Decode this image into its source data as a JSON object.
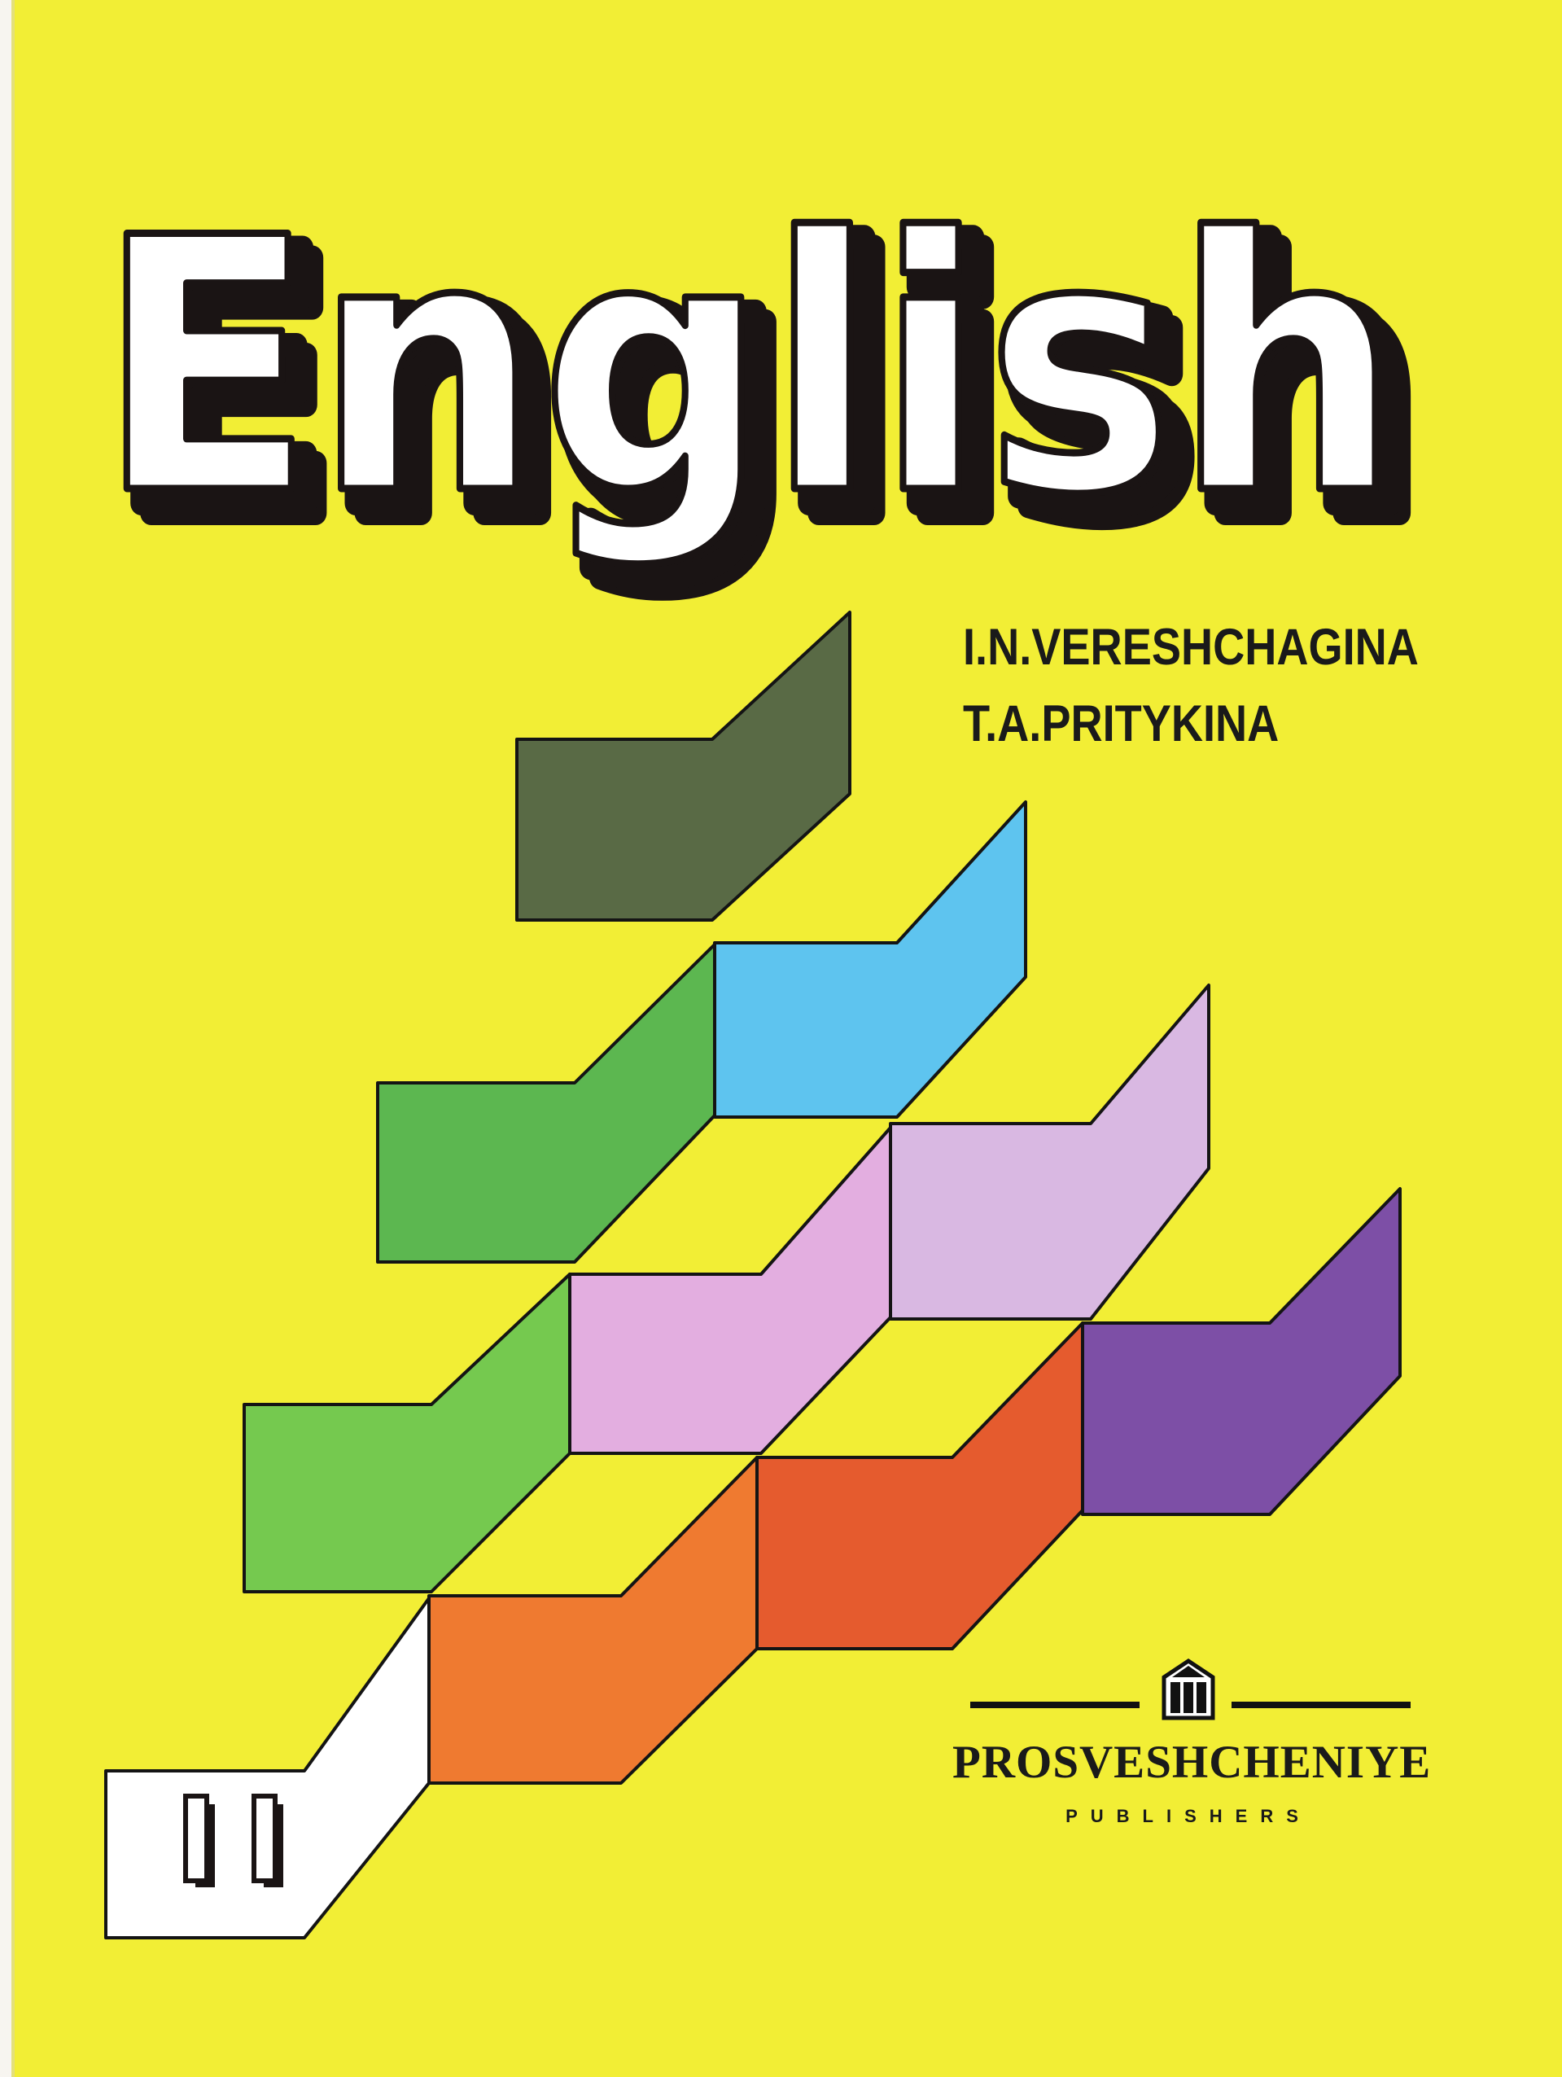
{
  "cover": {
    "title": "English",
    "authors": [
      "I.N.VERESHCHAGINA",
      "T.A.PRITYKINA"
    ],
    "volume": "II",
    "publisher": {
      "name": "PROSVESHCHENIYE",
      "subtitle": "PUBLISHERS",
      "logo_icon": "prosveshcheniye-logo-icon"
    }
  },
  "colors": {
    "background": "#f2ee35",
    "title_fill": "#ffffff",
    "title_shadow": "#1a1414",
    "block_olive": "#596a45",
    "block_sky_blue": "#5ec4ef",
    "block_green": "#5cb750",
    "block_lilac": "#d9b8e2",
    "block_pink": "#e3aee0",
    "block_light_green": "#75c94f",
    "block_purple": "#7d4fa6",
    "block_orange": "#ef7a30",
    "block_red_orange": "#e55b2e",
    "block_white": "#ffffff"
  }
}
